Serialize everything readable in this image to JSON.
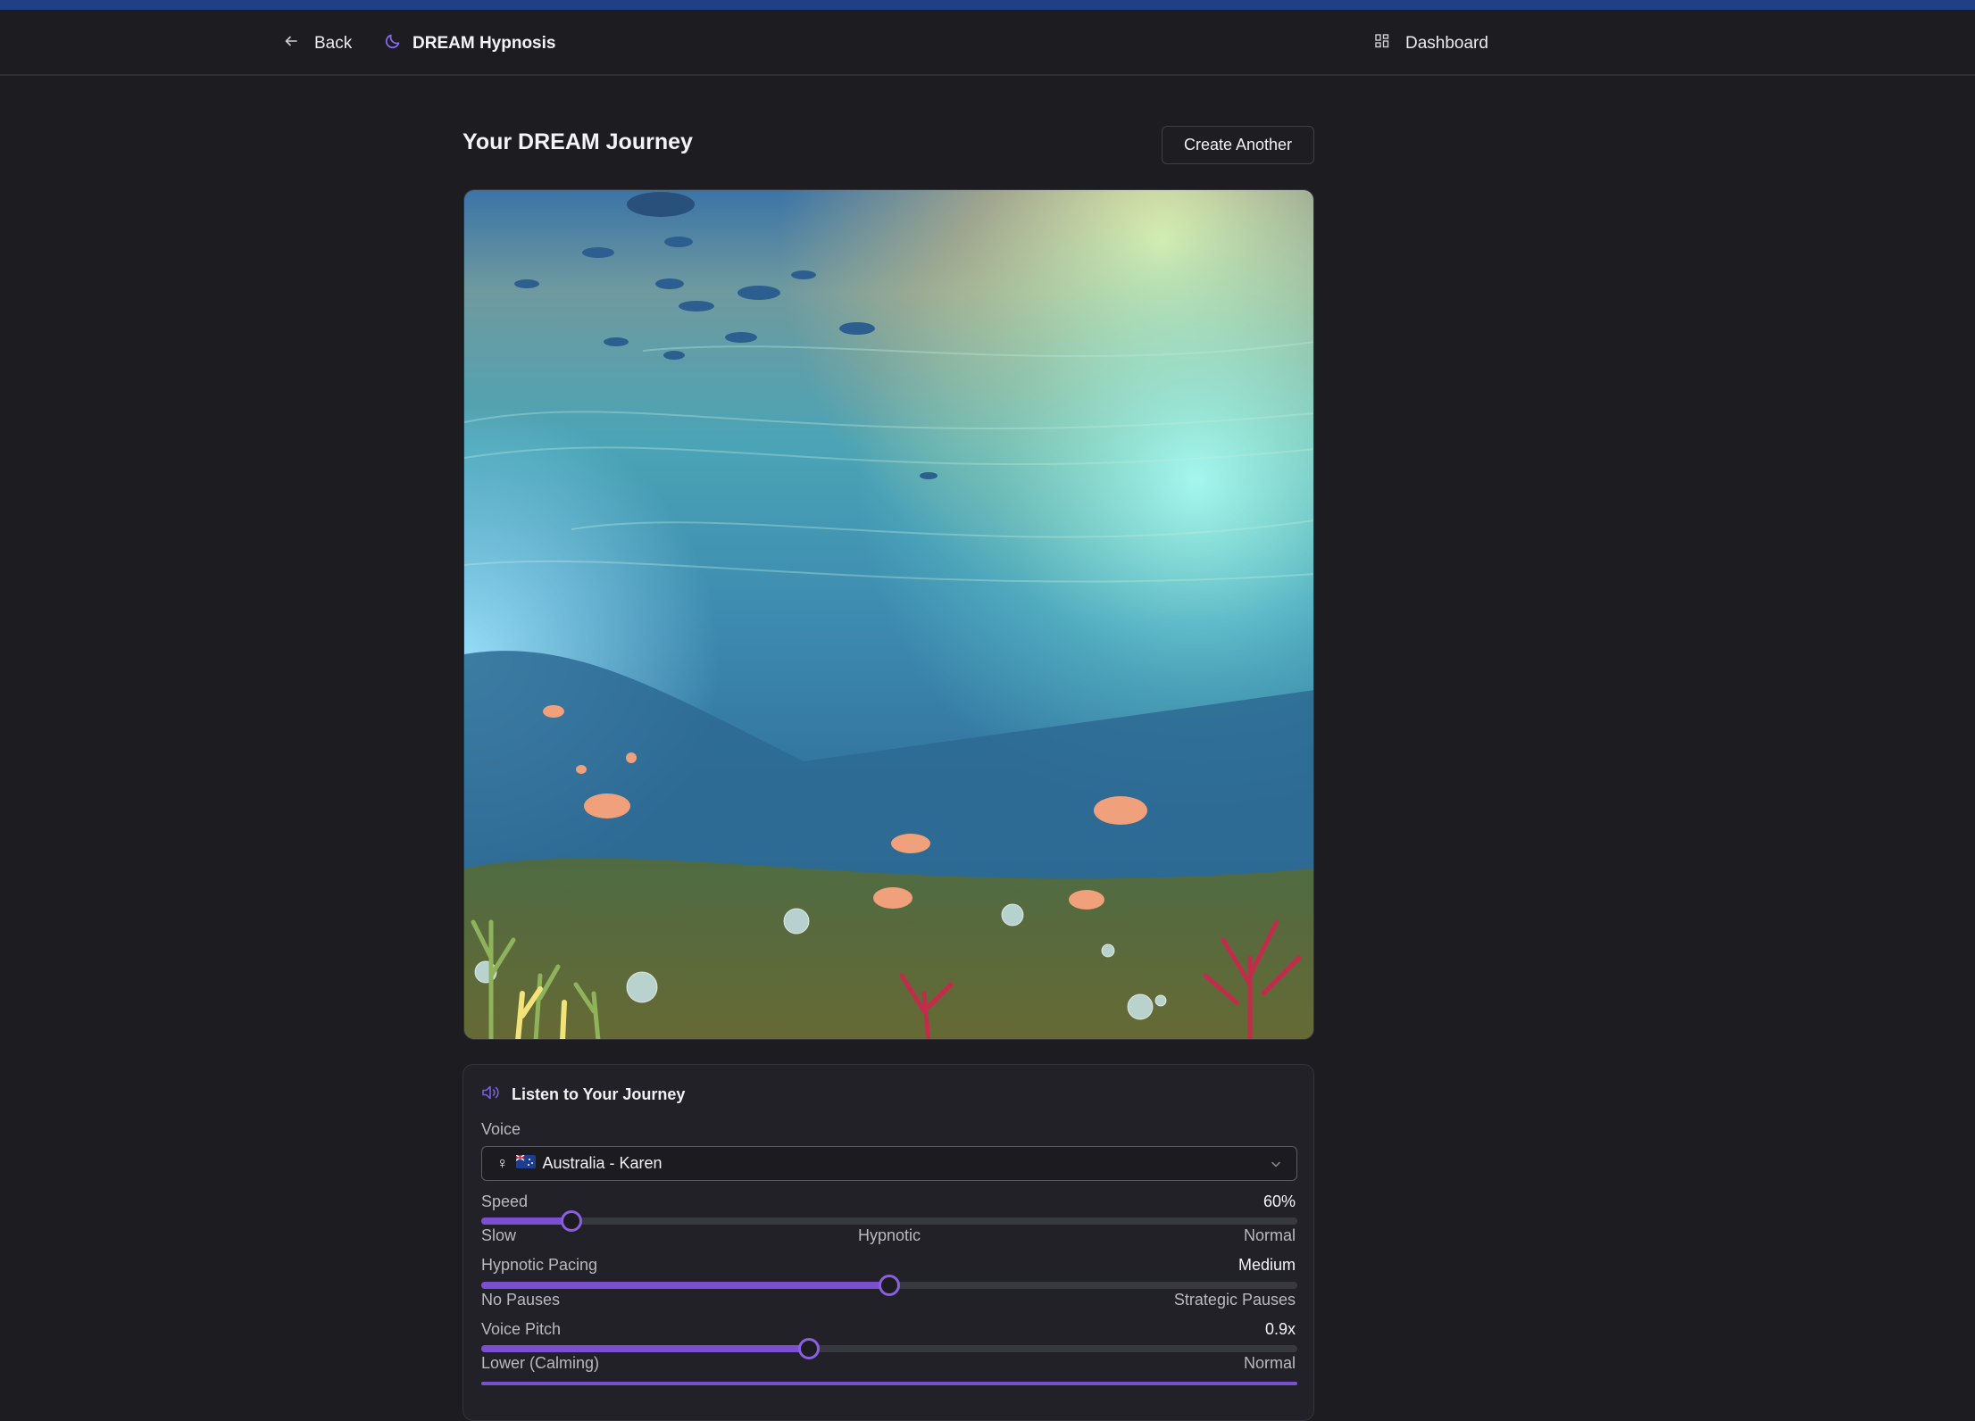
{
  "nav": {
    "back_label": "Back",
    "brand": "DREAM Hypnosis",
    "dashboard_label": "Dashboard"
  },
  "page": {
    "title": "Your DREAM Journey",
    "create_label": "Create Another"
  },
  "audio": {
    "heading": "Listen to Your Journey",
    "voice": {
      "label": "Voice",
      "gender_symbol": "♀",
      "selected": "Australia - Karen"
    },
    "speed": {
      "label": "Speed",
      "value_text": "60%",
      "value": 0.11,
      "min_label": "Slow",
      "mid_label": "Hypnotic",
      "max_label": "Normal"
    },
    "pacing": {
      "label": "Hypnotic Pacing",
      "value_text": "Medium",
      "value": 0.5,
      "min_label": "No Pauses",
      "max_label": "Strategic Pauses"
    },
    "pitch": {
      "label": "Voice Pitch",
      "value_text": "0.9x",
      "value": 0.402,
      "min_label": "Lower (Calming)",
      "max_label": "Normal"
    }
  },
  "colors": {
    "accent": "#7b4fd1",
    "brand_icon": "#8a6cf0",
    "header_strip": "#1f3f86"
  }
}
